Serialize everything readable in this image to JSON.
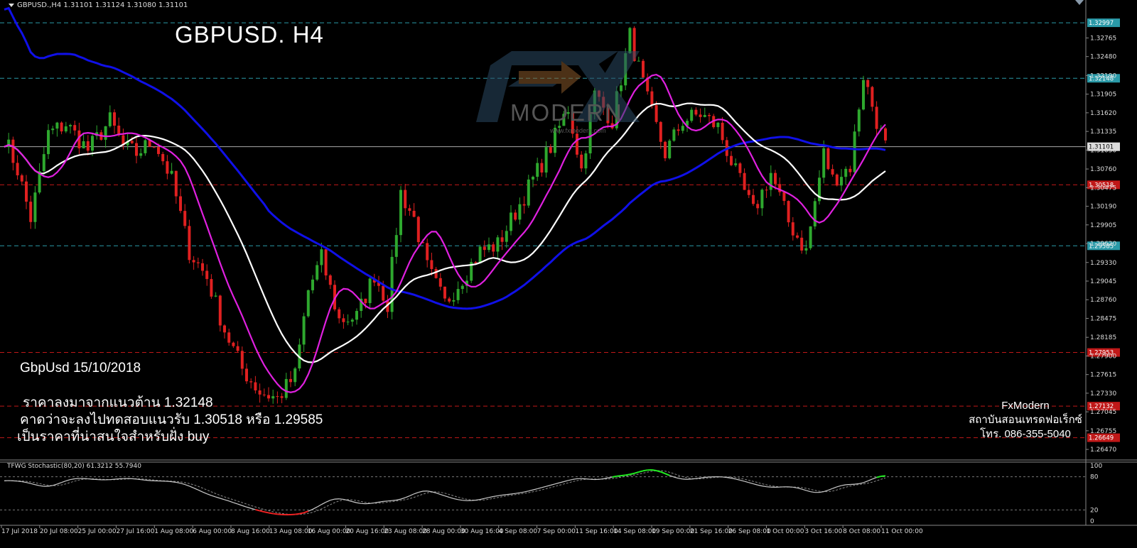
{
  "header": {
    "symbol_info": "GBPUSD.,H4  1.31101 1.31124 1.31080 1.31101"
  },
  "title": "GBPUSD. H4",
  "logo": {
    "brand_letters": "FX",
    "brand_word": "MODERN",
    "url": "www.fxmodern.com"
  },
  "analysis": {
    "date_line": "GbpUsd 15/10/2018",
    "lines": [
      "ราคาลงมาจากแนวต้าน 1.32148",
      " คาดว่าจะลงไปทดสอบแนวรับ 1.30518 หรือ 1.29585",
      "เป็นราคาที่น่าสนใจสำหรับฝั่ง buy"
    ]
  },
  "signature": {
    "name": "FxModern",
    "institute": "สถาบันสอนเทรดฟอเร็กซ์",
    "phone": "โทร. 086-355-5040"
  },
  "stochastic_label": "TFWG Stochastic(80,20) 61.3212 55.7940",
  "colors": {
    "background": "#000000",
    "bull_candle": "#2ea82e",
    "bear_candle": "#e02020",
    "ma_magenta": "#e020e0",
    "ma_white": "#ffffff",
    "ma_blue": "#1010e8",
    "resistance_line": "#2a9aa8",
    "support_line": "#c01818",
    "stoch_line": "#cccccc",
    "stoch_overbought": "#22ee22",
    "stoch_oversold": "#ee2222"
  },
  "chart_data": {
    "type": "line",
    "instrument": "GBPUSD",
    "timeframe": "H4",
    "y_axis_ticks": [
      "1.32765",
      "1.32480",
      "1.32190",
      "1.31905",
      "1.31620",
      "1.31335",
      "1.31050",
      "1.30760",
      "1.30475",
      "1.30190",
      "1.29905",
      "1.29620",
      "1.29330",
      "1.29045",
      "1.28760",
      "1.28475",
      "1.28185",
      "1.27900",
      "1.27615",
      "1.27330",
      "1.27045",
      "1.26755",
      "1.26470"
    ],
    "ylim": [
      1.2633,
      1.3315
    ],
    "levels": [
      {
        "label": "1.32997",
        "value": 1.32997,
        "kind": "resistance"
      },
      {
        "label": "1.32148",
        "value": 1.32148,
        "kind": "resistance"
      },
      {
        "label": "1.31101",
        "value": 1.31101,
        "kind": "current"
      },
      {
        "label": "1.30518",
        "value": 1.30518,
        "kind": "support"
      },
      {
        "label": "1.29585",
        "value": 1.29585,
        "kind": "resistance"
      },
      {
        "label": "1.27953",
        "value": 1.27953,
        "kind": "support"
      },
      {
        "label": "1.27132",
        "value": 1.27132,
        "kind": "support"
      },
      {
        "label": "1.26649",
        "value": 1.26649,
        "kind": "support"
      }
    ],
    "x_labels": [
      "17 Jul 2018",
      "20 Jul 08:00",
      "25 Jul 00:00",
      "27 Jul 16:00",
      "1 Aug 08:00",
      "6 Aug 00:00",
      "8 Aug 16:00",
      "13 Aug 08:00",
      "16 Aug 00:00",
      "20 Aug 16:00",
      "23 Aug 08:00",
      "28 Aug 00:00",
      "30 Aug 16:00",
      "4 Sep 08:00",
      "7 Sep 00:00",
      "11 Sep 16:00",
      "14 Sep 08:00",
      "19 Sep 00:00",
      "21 Sep 16:00",
      "26 Sep 08:00",
      "1 Oct 00:00",
      "3 Oct 16:00",
      "8 Oct 08:00",
      "11 Oct 00:00"
    ],
    "price_path": {
      "x_index": [
        0,
        3,
        6,
        10,
        14,
        19,
        24,
        27,
        30,
        34,
        38,
        42,
        46,
        50,
        54,
        58,
        62,
        66,
        69,
        72,
        76,
        80,
        84,
        87,
        90,
        93,
        96,
        100,
        104,
        108,
        112,
        116,
        120,
        124,
        128,
        131,
        134,
        138,
        142,
        146,
        150,
        154,
        158,
        162,
        166,
        170,
        174,
        178,
        182,
        186,
        188,
        192,
        195,
        198,
        200
      ],
      "close": [
        1.3125,
        1.3075,
        1.3,
        1.313,
        1.3145,
        1.3105,
        1.315,
        1.311,
        1.31,
        1.312,
        1.306,
        1.295,
        1.291,
        1.283,
        1.277,
        1.2735,
        1.2725,
        1.276,
        1.289,
        1.294,
        1.2845,
        1.285,
        1.2915,
        1.287,
        1.304,
        1.3,
        1.2925,
        1.287,
        1.291,
        1.295,
        1.296,
        1.301,
        1.306,
        1.311,
        1.317,
        1.3075,
        1.319,
        1.315,
        1.328,
        1.318,
        1.31,
        1.315,
        1.316,
        1.314,
        1.307,
        1.301,
        1.307,
        1.2995,
        1.295,
        1.31,
        1.306,
        1.308,
        1.322,
        1.315,
        1.311
      ]
    },
    "y_label_stoch_ticks": [
      "100",
      "80",
      "20",
      "0"
    ],
    "stochastic_last": [
      61.3212,
      55.794
    ]
  }
}
